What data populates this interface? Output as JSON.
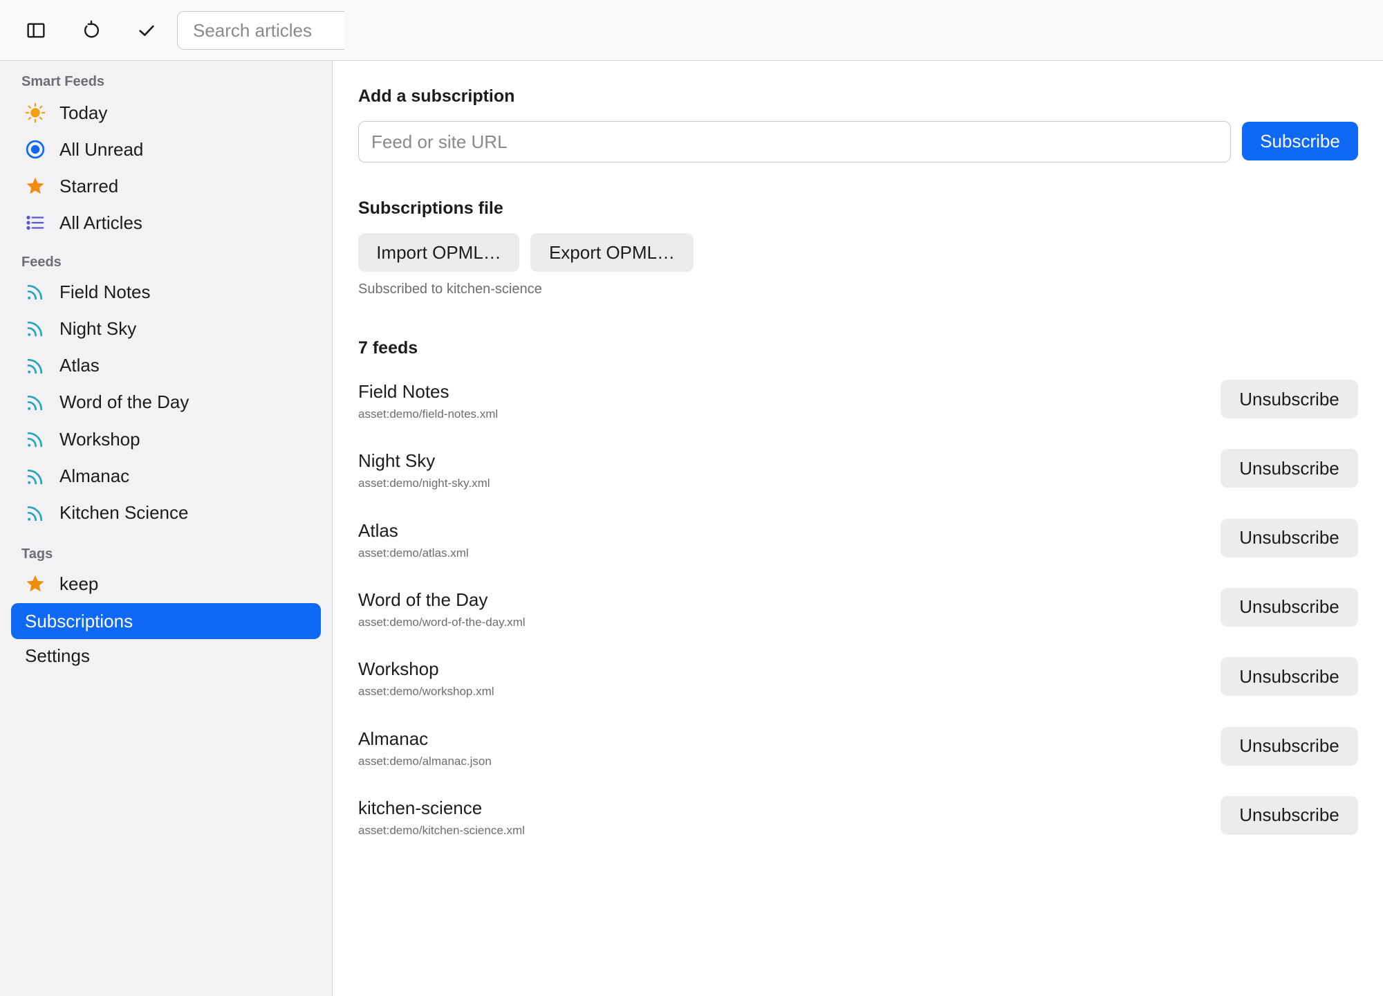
{
  "toolbar": {
    "sidebar_toggle_icon": "sidebar-icon",
    "refresh_icon": "refresh-icon",
    "mark_read_icon": "checkmark-icon",
    "search_placeholder": "Search articles"
  },
  "sidebar": {
    "smart_feeds_label": "Smart Feeds",
    "smart_feeds": [
      {
        "label": "Today",
        "icon": "sun-icon"
      },
      {
        "label": "All Unread",
        "icon": "unread-dot-icon"
      },
      {
        "label": "Starred",
        "icon": "star-icon"
      },
      {
        "label": "All Articles",
        "icon": "list-icon"
      }
    ],
    "feeds_label": "Feeds",
    "feeds": [
      {
        "label": "Field Notes",
        "icon": "rss-icon"
      },
      {
        "label": "Night Sky",
        "icon": "rss-icon"
      },
      {
        "label": "Atlas",
        "icon": "rss-icon"
      },
      {
        "label": "Word of the Day",
        "icon": "rss-icon"
      },
      {
        "label": "Workshop",
        "icon": "rss-icon"
      },
      {
        "label": "Almanac",
        "icon": "rss-icon"
      },
      {
        "label": "Kitchen Science",
        "icon": "rss-icon"
      }
    ],
    "tags_label": "Tags",
    "tags": [
      {
        "label": "keep",
        "icon": "star-icon"
      }
    ],
    "subscriptions_label": "Subscriptions",
    "settings_label": "Settings"
  },
  "main": {
    "add_heading": "Add a subscription",
    "url_placeholder": "Feed or site URL",
    "subscribe_label": "Subscribe",
    "file_heading": "Subscriptions file",
    "import_label": "Import OPML…",
    "export_label": "Export OPML…",
    "status_text": "Subscribed to kitchen-science",
    "feeds_heading": "7 feeds",
    "unsubscribe_label": "Unsubscribe",
    "feeds": [
      {
        "name": "Field Notes",
        "url": "asset:demo/field-notes.xml"
      },
      {
        "name": "Night Sky",
        "url": "asset:demo/night-sky.xml"
      },
      {
        "name": "Atlas",
        "url": "asset:demo/atlas.xml"
      },
      {
        "name": "Word of the Day",
        "url": "asset:demo/word-of-the-day.xml"
      },
      {
        "name": "Workshop",
        "url": "asset:demo/workshop.xml"
      },
      {
        "name": "Almanac",
        "url": "asset:demo/almanac.json"
      },
      {
        "name": "kitchen-science",
        "url": "asset:demo/kitchen-science.xml"
      }
    ]
  },
  "colors": {
    "accent": "#0f69f5",
    "sun": "#f5a00f",
    "star": "#f08c0a",
    "rss": "#2aa7bd",
    "list": "#5856d6"
  }
}
